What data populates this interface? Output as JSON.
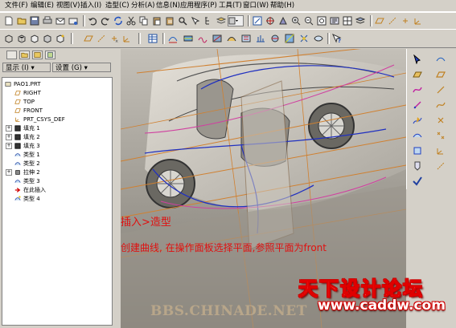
{
  "menu": {
    "items": [
      "文件(F)",
      "编辑(E)",
      "视图(V)",
      "插入(I)",
      "造型(C)",
      "分析(A)",
      "信息(N)",
      "应用程序(P)",
      "工具(T)",
      "窗口(W)",
      "帮助(H)"
    ]
  },
  "sidebar": {
    "show_label": "显示 (I) ▾",
    "settings_label": "设置 (G) ▾",
    "tree": [
      {
        "label": "PAO1.PRT",
        "icon": "part-icon",
        "expander": false,
        "indent": 0
      },
      {
        "label": "RIGHT",
        "icon": "datum-plane-icon",
        "expander": false,
        "indent": 1
      },
      {
        "label": "TOP",
        "icon": "datum-plane-icon",
        "expander": false,
        "indent": 1
      },
      {
        "label": "FRONT",
        "icon": "datum-plane-icon",
        "expander": false,
        "indent": 1
      },
      {
        "label": "PRT_CSYS_DEF",
        "icon": "csys-icon",
        "expander": false,
        "indent": 1
      },
      {
        "label": "填充 1",
        "icon": "fill-icon",
        "expander": true,
        "indent": 1
      },
      {
        "label": "填充 2",
        "icon": "fill-icon",
        "expander": true,
        "indent": 1
      },
      {
        "label": "填充 3",
        "icon": "fill-icon",
        "expander": true,
        "indent": 1
      },
      {
        "label": "类型 1",
        "icon": "style-icon",
        "expander": false,
        "indent": 1
      },
      {
        "label": "类型 2",
        "icon": "style-icon",
        "expander": false,
        "indent": 1
      },
      {
        "label": "拉伸 2",
        "icon": "extrude-icon",
        "expander": true,
        "indent": 1
      },
      {
        "label": "类型 3",
        "icon": "style-icon",
        "expander": false,
        "indent": 1
      },
      {
        "label": "在此插入",
        "icon": "insert-here-arrow-icon",
        "expander": false,
        "indent": 1
      },
      {
        "label": "类型 4",
        "icon": "style-active-icon",
        "expander": false,
        "indent": 1
      }
    ]
  },
  "overlay": {
    "step_title": "插入>造型",
    "instruction": "创建曲线, 在操作面板选择平面,参照平面为front"
  },
  "watermark": {
    "site": "BBS.CHINADE.NET",
    "logo_cn": "天下设计论坛",
    "logo_url": "www.caddw.com"
  },
  "colors": {
    "chrome": "#d4d0c8",
    "overlay_text": "#e01010",
    "logo_red": "#e00000",
    "viewport_bg": "#9c9890"
  }
}
